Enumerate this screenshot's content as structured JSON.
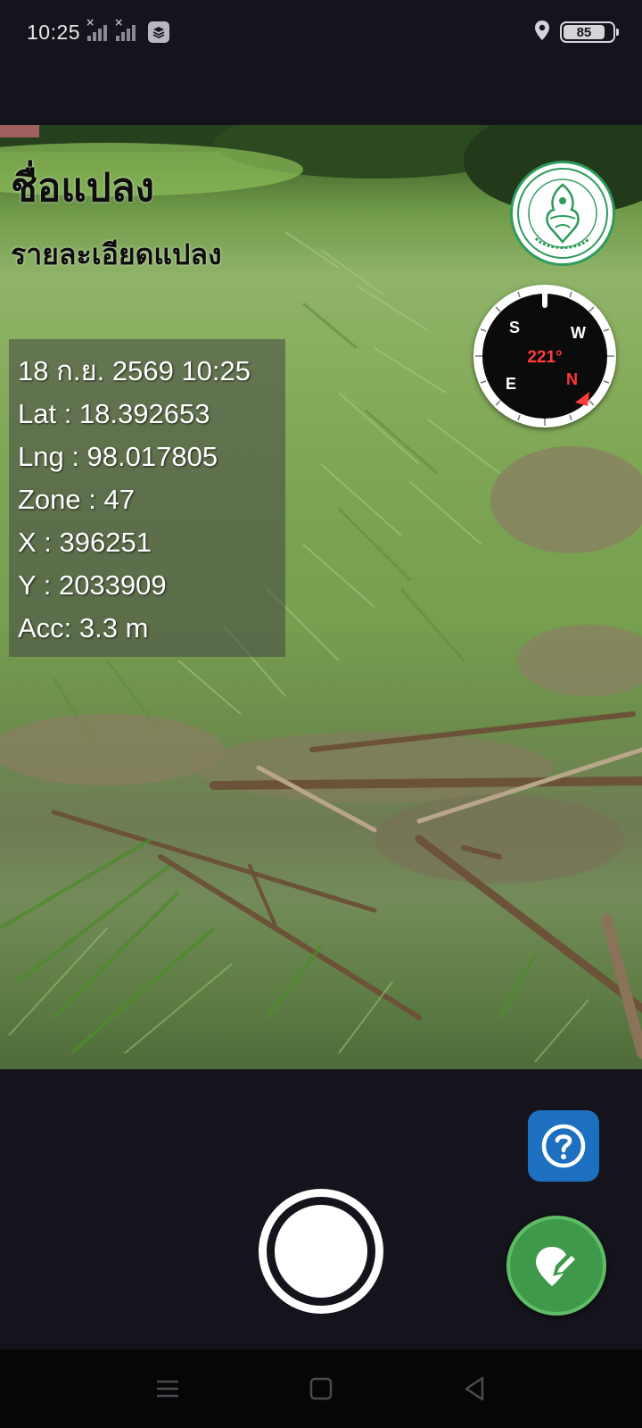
{
  "status_bar": {
    "time": "10:25",
    "battery_level": "85",
    "icons": [
      "signal-no-service-icon",
      "signal-no-service-icon",
      "app-notification-icon",
      "location-icon",
      "battery-icon"
    ]
  },
  "overlay": {
    "title": "ชื่อแปลง",
    "subtitle": "รายละเอียดแปลง",
    "info": {
      "datetime": "18 ก.ย. 2569 10:25",
      "lat": "Lat : 18.392653",
      "lng": "Lng : 98.017805",
      "zone": "Zone : 47",
      "x": "X : 396251",
      "y": "Y : 2033909",
      "acc": "Acc: 3.3 m"
    }
  },
  "compass": {
    "heading": "221°",
    "letters": {
      "n": "N",
      "e": "E",
      "s": "S",
      "w": "W"
    }
  },
  "controls": {
    "help_icon": "question-circle-icon",
    "shutter_icon": "shutter-icon",
    "edit_location_icon": "location-edit-icon"
  },
  "colors": {
    "background": "#15131b",
    "help_button": "#1d6fc0",
    "edit_location_button": "#3e9a4a",
    "compass_accent": "#ff3b3b",
    "seal_green": "#2e9b5c"
  }
}
